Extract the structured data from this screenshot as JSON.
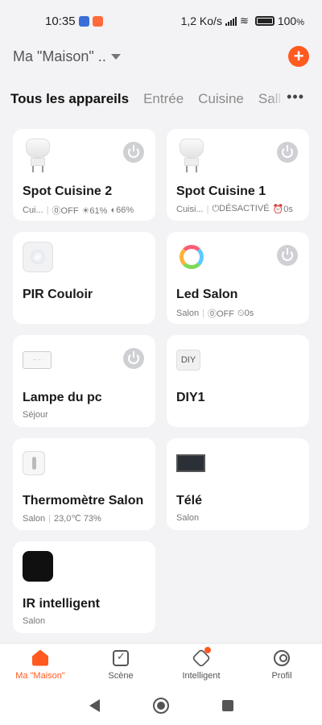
{
  "status_bar": {
    "time": "10:35",
    "network_speed": "1,2 Ko/s",
    "battery": "100",
    "battery_unit": "%"
  },
  "header": {
    "home_name": "Ma \"Maison\" ..",
    "add_icon": "plus-icon",
    "accent_color": "#ff5a1f"
  },
  "tabs": [
    "Tous les appareils",
    "Entrée",
    "Cuisine",
    "Salle"
  ],
  "tabs_more": "•••",
  "devices": [
    {
      "name": "Spot Cuisine 2",
      "icon": "bulb-icon",
      "power": true,
      "sub": [
        "Cui...",
        "⓪OFF",
        "☀61%",
        "◐66%"
      ]
    },
    {
      "name": "Spot Cuisine 1",
      "icon": "bulb-icon",
      "power": true,
      "sub": [
        "Cuisi...",
        "⏻DÉSACTIVÉ",
        "⏰0s"
      ]
    },
    {
      "name": "PIR Couloir",
      "icon": "motion-sensor-icon",
      "power": false,
      "sub": []
    },
    {
      "name": "Led Salon",
      "icon": "led-ring-icon",
      "power": true,
      "sub": [
        "Salon",
        "⓪OFF",
        "⏲0s"
      ]
    },
    {
      "name": "Lampe du pc",
      "icon": "controller-icon",
      "power": true,
      "sub": [
        "Séjour"
      ]
    },
    {
      "name": "DIY1",
      "icon": "diy-icon",
      "power": false,
      "sub": []
    },
    {
      "name": "Thermomètre Salon",
      "icon": "thermometer-icon",
      "power": false,
      "sub": [
        "Salon",
        "23,0℃ 73%"
      ]
    },
    {
      "name": "Télé",
      "icon": "tv-icon",
      "power": false,
      "sub": [
        "Salon"
      ]
    },
    {
      "name": "IR intelligent",
      "icon": "ir-remote-icon",
      "power": false,
      "sub": [
        "Salon"
      ]
    }
  ],
  "bottom_nav": {
    "home": "Ma \"Maison\"",
    "scene": "Scène",
    "smart": "Intelligent",
    "profile": "Profil"
  }
}
